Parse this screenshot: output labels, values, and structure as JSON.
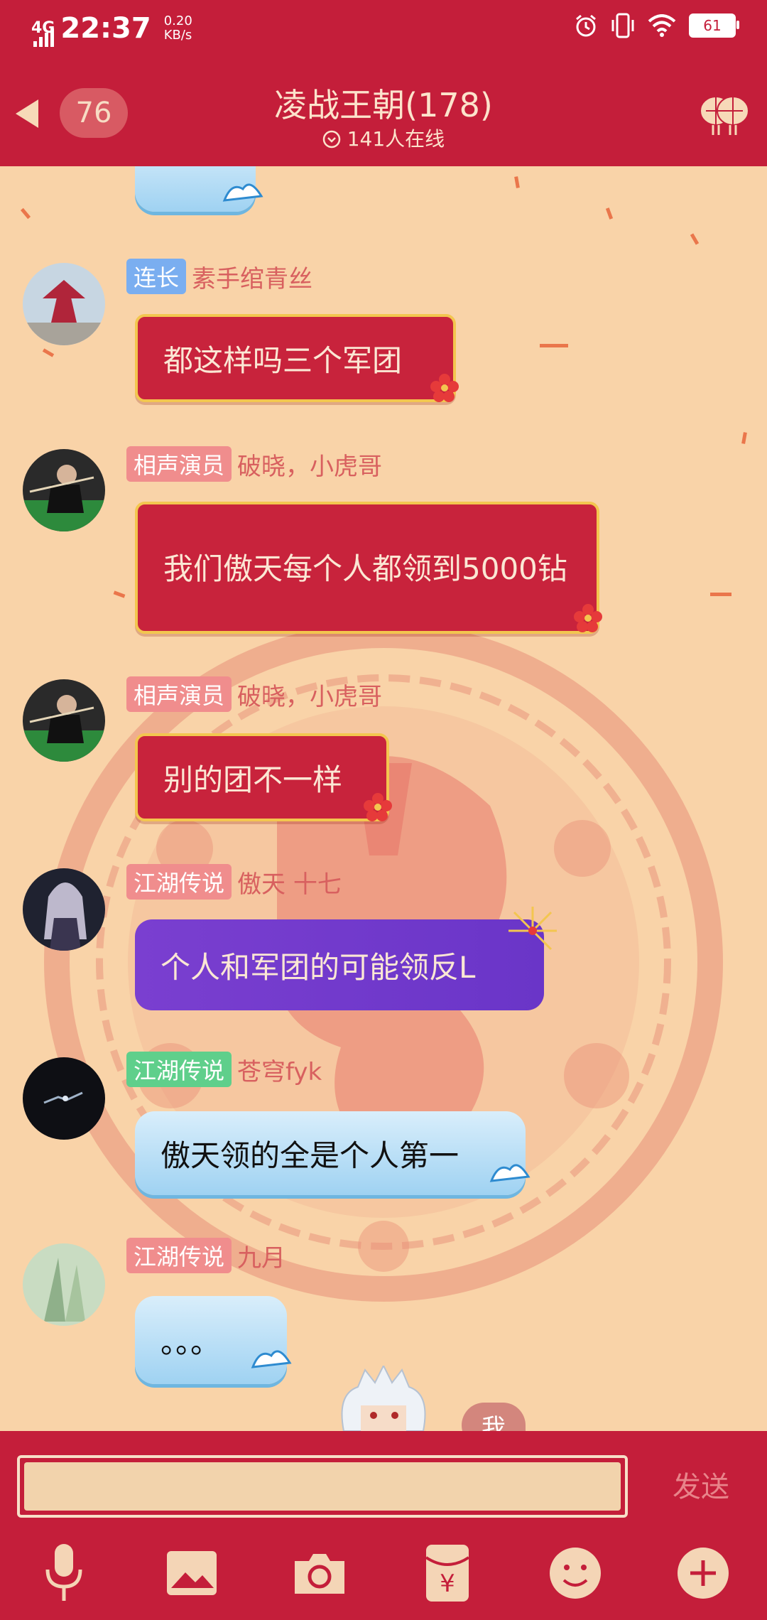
{
  "status_bar": {
    "network": "4G",
    "time": "22:37",
    "speed_value": "0.20",
    "speed_unit": "KB/s",
    "battery": "61"
  },
  "header": {
    "unread_count": "76",
    "title": "凌战王朝(178)",
    "online": "141人在线"
  },
  "messages": [
    {
      "badge": "连长",
      "badge_color": "#7aaef0",
      "name": "素手绾青丝",
      "text": "都这样吗三个军团",
      "style": "red"
    },
    {
      "badge": "相声演员",
      "badge_color": "#f08d8d",
      "name": "破晓，小虎哥",
      "text": "我们傲天每个人都领到5000钻",
      "style": "red"
    },
    {
      "badge": "相声演员",
      "badge_color": "#f08d8d",
      "name": "破晓，小虎哥",
      "text": "别的团不一样",
      "style": "red"
    },
    {
      "badge": "江湖传说",
      "badge_color": "#f08d8d",
      "name": "傲天   十七",
      "text": "个人和军团的可能领反L",
      "style": "purple"
    },
    {
      "badge": "江湖传说",
      "badge_color": "#5fcf8b",
      "name": "苍穹fyk",
      "text": "傲天领的全是个人第一",
      "style": "blue"
    },
    {
      "badge": "江湖传说",
      "badge_color": "#f08d8d",
      "name": "九月",
      "text": "。。。",
      "style": "blue"
    }
  ],
  "me_label": "我",
  "input": {
    "placeholder": "",
    "send_label": "发送"
  },
  "toolbar": [
    "microphone-icon",
    "image-icon",
    "camera-icon",
    "red-packet-icon",
    "emoji-icon",
    "plus-icon"
  ],
  "colors": {
    "header_bg": "#c41e3a",
    "chat_bg": "#f9d3a8",
    "bubble_red": "#c8233c",
    "bubble_border": "#f3c64f"
  }
}
